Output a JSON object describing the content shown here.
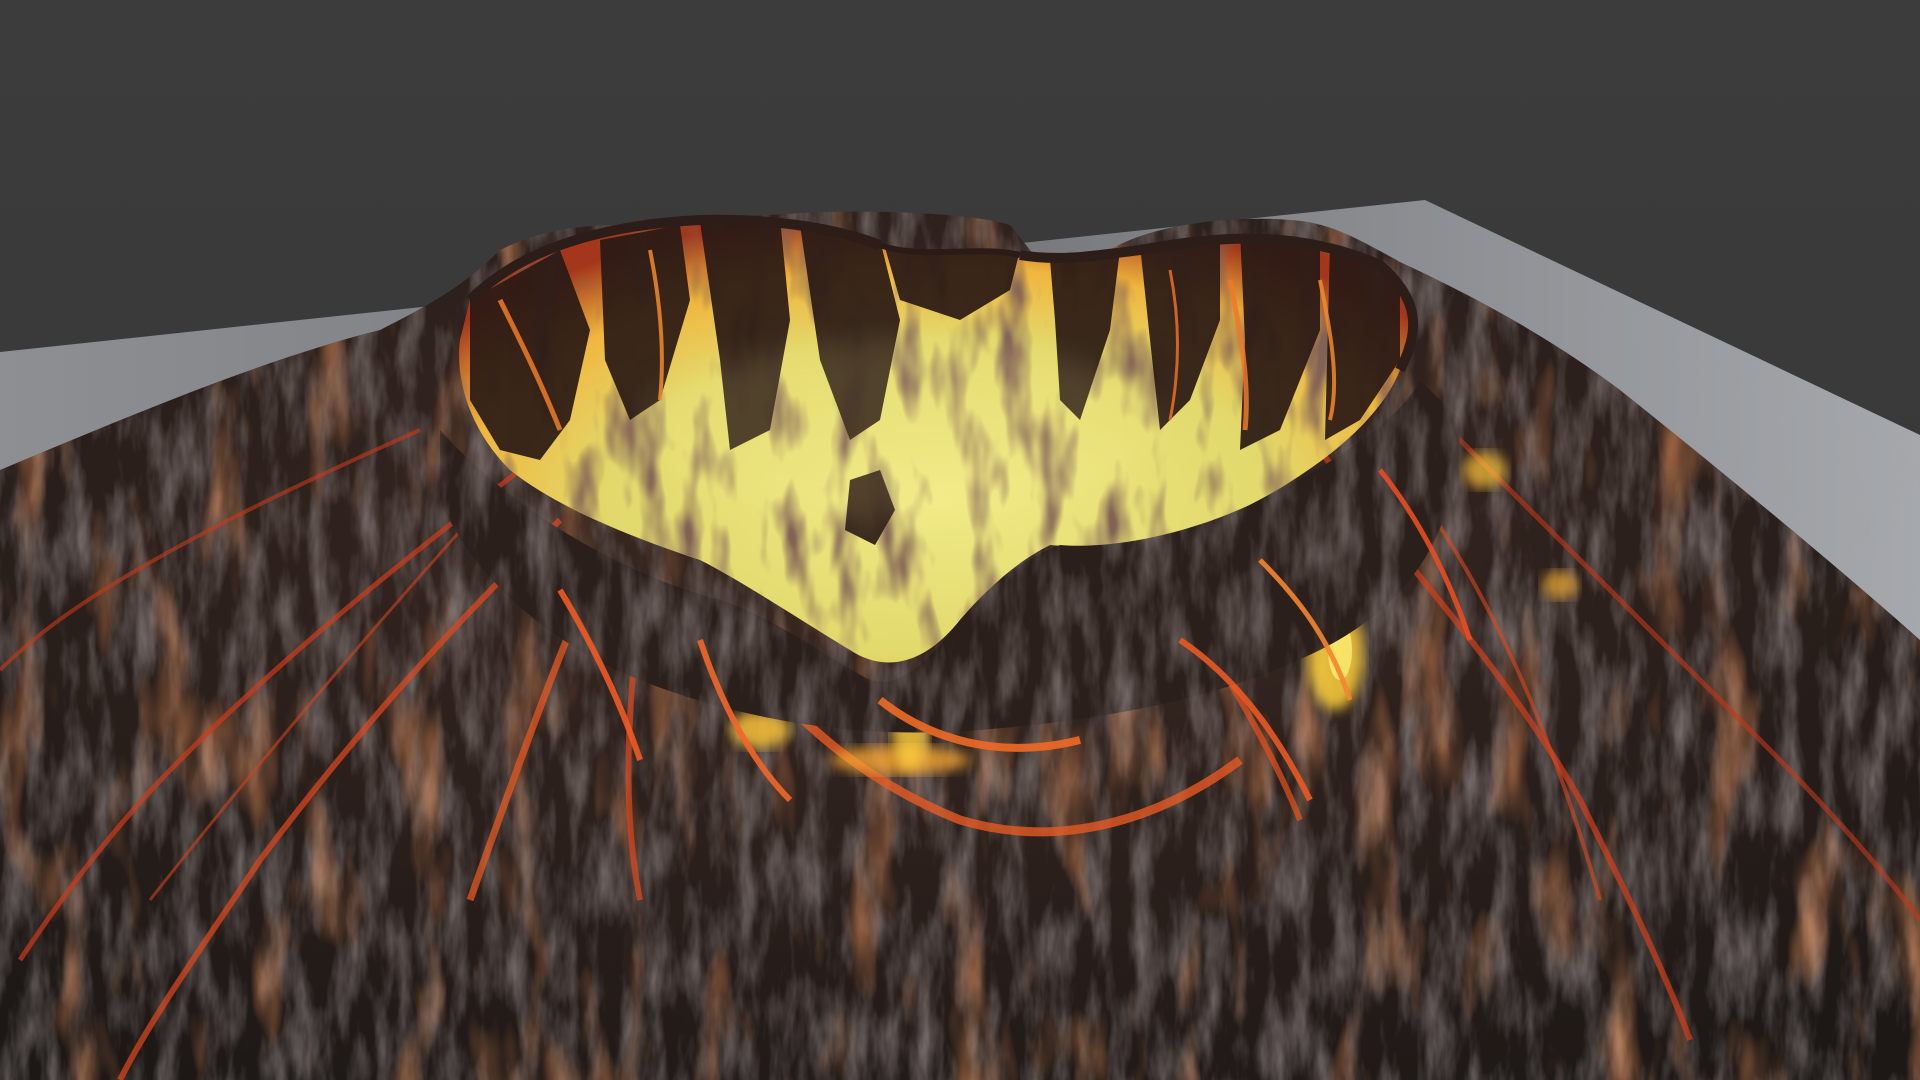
{
  "scene": {
    "subject": "volcano-crater-render",
    "colors": {
      "background": "#3b3b3b",
      "ground_plane": "#7a7c80",
      "ground_plane_light": "#a3a6aa",
      "rock_dark": "#231a17",
      "rock_mid": "#3a2a24",
      "rock_highlight": "#5e5555",
      "lava_red": "#d4371c",
      "lava_orange": "#f06a23",
      "lava_yellow": "#ffd43c",
      "crater_floor": "#e6e47a",
      "crater_floor_glow": "#f3d45a"
    }
  }
}
